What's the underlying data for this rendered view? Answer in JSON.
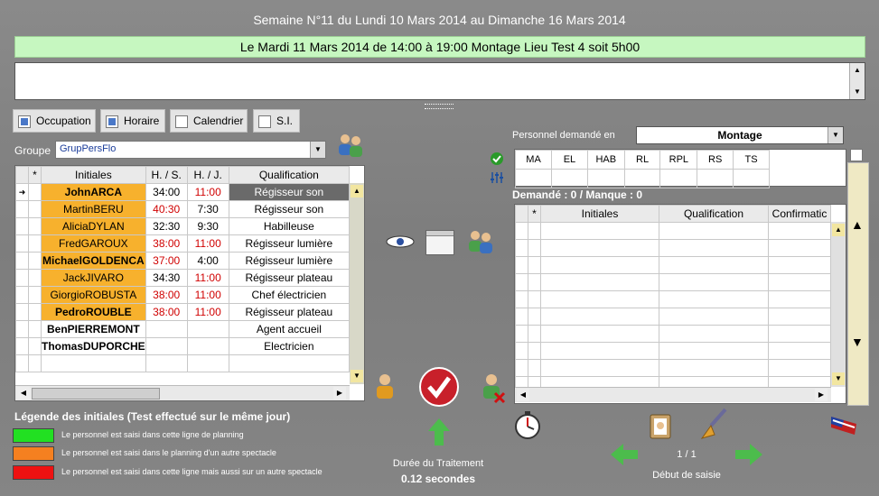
{
  "header": {
    "week_title": "Semaine N°11 du Lundi 10 Mars 2014 au Dimanche 16 Mars 2014",
    "date_bar": "Le Mardi 11 Mars 2014  de  14:00  à  19:00  Montage  Lieu Test 4 soit 5h00"
  },
  "filters": {
    "occupation": "Occupation",
    "horaire": "Horaire",
    "calendrier": "Calendrier",
    "si": "S.I."
  },
  "group": {
    "label": "Groupe",
    "value": "GrupPersFlo"
  },
  "left_table": {
    "columns": [
      "*",
      "Initiales",
      "H. / S.",
      "H. / J.",
      "Qualification"
    ],
    "rows": [
      {
        "initiales": "JohnARCA",
        "hs": "34:00",
        "hj": "11:00",
        "qual": "Régisseur son"
      },
      {
        "initiales": "MartinBERU",
        "hs": "40:30",
        "hj": "7:30",
        "qual": "Régisseur son"
      },
      {
        "initiales": "AliciaDYLAN",
        "hs": "32:30",
        "hj": "9:30",
        "qual": "Habilleuse"
      },
      {
        "initiales": "FredGAROUX",
        "hs": "38:00",
        "hj": "11:00",
        "qual": "Régisseur lumière"
      },
      {
        "initiales": "MichaelGOLDENCA",
        "hs": "37:00",
        "hj": "4:00",
        "qual": "Régisseur lumière"
      },
      {
        "initiales": "JackJIVARO",
        "hs": "34:30",
        "hj": "11:00",
        "qual": "Régisseur plateau"
      },
      {
        "initiales": "GiorgioROBUSTA",
        "hs": "38:00",
        "hj": "11:00",
        "qual": "Chef électricien"
      },
      {
        "initiales": "PedroROUBLE",
        "hs": "38:00",
        "hj": "11:00",
        "qual": "Régisseur plateau"
      },
      {
        "initiales": "BenPIERREMONT",
        "hs": "",
        "hj": "",
        "qual": "Agent accueil"
      },
      {
        "initiales": "ThomasDUPORCHE",
        "hs": "",
        "hj": "",
        "qual": "Electricien"
      }
    ]
  },
  "legend": {
    "title": "Légende des initiales (Test effectué sur le même jour)",
    "items": [
      {
        "color": "#22e022",
        "text": "Le personnel est saisi dans cette ligne de planning"
      },
      {
        "color": "#f58020",
        "text": "Le personnel est saisi  dans le planning d'un autre spectacle"
      },
      {
        "color": "#ee1111",
        "text": "Le personnel est saisi dans cette ligne mais aussi sur un autre spectacle"
      }
    ]
  },
  "right": {
    "personnel_label": "Personnel demandé en",
    "personnel_value": "Montage",
    "qual_codes": [
      "MA",
      "EL",
      "HAB",
      "RL",
      "RPL",
      "RS",
      "TS"
    ],
    "demande_text": "Demandé : 0 / Manque : 0",
    "table_columns": [
      "*",
      "Initiales",
      "Qualification",
      "Confirmatic"
    ]
  },
  "footer": {
    "duree_label": "Durée du Traitement",
    "duree_value": "0.12 secondes",
    "pager": "1 / 1",
    "debut": "Début de saisie"
  }
}
